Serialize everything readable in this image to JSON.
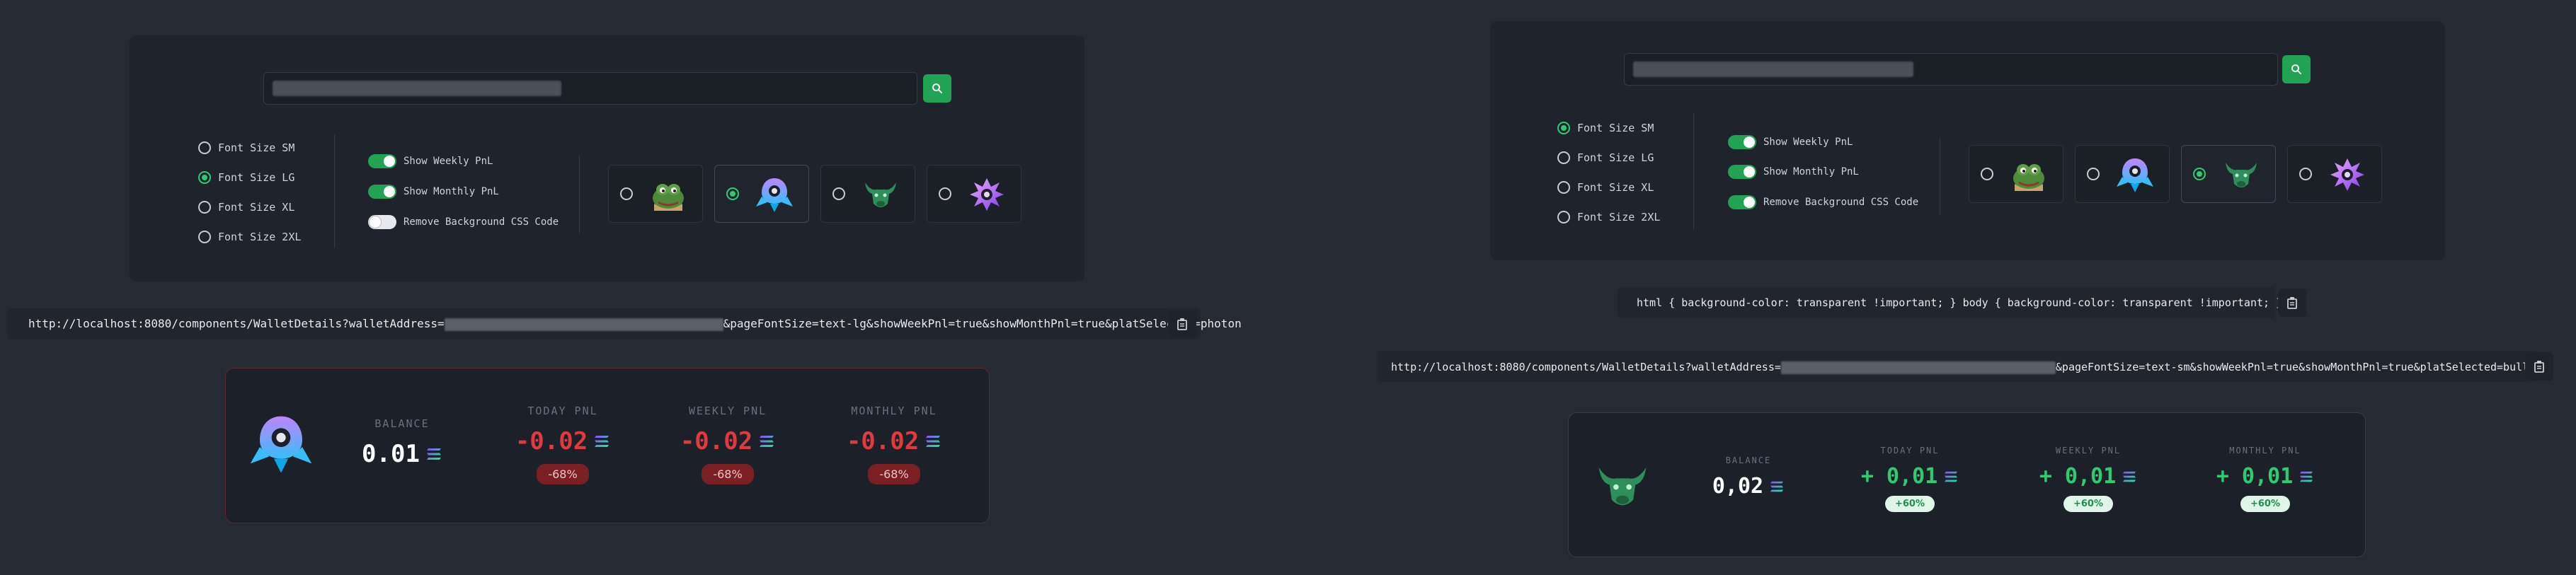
{
  "colors": {
    "background": "#252a33",
    "panel": "#1f242c",
    "accent_green": "#22a354",
    "negative_red": "#e0393e",
    "positive_green": "#2ecc71"
  },
  "left": {
    "font_options": [
      "Font Size SM",
      "Font Size LG",
      "Font Size XL",
      "Font Size 2XL"
    ],
    "font_selected": "Font Size LG",
    "toggles": [
      {
        "label": "Show Weekly PnL",
        "on": true
      },
      {
        "label": "Show Monthly PnL",
        "on": true
      },
      {
        "label": "Remove Background CSS Code",
        "on": false
      }
    ],
    "platforms": [
      "pepe",
      "photon",
      "bullx",
      "axiom"
    ],
    "platform_selected": "photon",
    "url_prefix": "http://localhost:8080/components/WalletDetails?walletAddress=",
    "url_suffix": "&pageFontSize=text-lg&showWeekPnl=true&showMonthPnl=true&platSelected=photon",
    "wallet": {
      "balance_label": "BALANCE",
      "balance": "0.01",
      "today_label": "TODAY PNL",
      "today": "-0.02",
      "today_pct": "-68%",
      "weekly_label": "WEEKLY PNL",
      "weekly": "-0.02",
      "weekly_pct": "-68%",
      "monthly_label": "MONTHLY PNL",
      "monthly": "-0.02",
      "monthly_pct": "-68%"
    }
  },
  "right": {
    "font_options": [
      "Font Size SM",
      "Font Size LG",
      "Font Size XL",
      "Font Size 2XL"
    ],
    "font_selected": "Font Size SM",
    "toggles": [
      {
        "label": "Show Weekly PnL",
        "on": true
      },
      {
        "label": "Show Monthly PnL",
        "on": true
      },
      {
        "label": "Remove Background CSS Code",
        "on": true
      }
    ],
    "platforms": [
      "pepe",
      "photon",
      "bullx",
      "axiom"
    ],
    "platform_selected": "bullx",
    "css_code": "html { background-color: transparent !important; } body { background-color: transparent !important; }",
    "url_prefix": "http://localhost:8080/components/WalletDetails?walletAddress=",
    "url_suffix": "&pageFontSize=text-sm&showWeekPnl=true&showMonthPnl=true&platSelected=bullx",
    "wallet": {
      "balance_label": "BALANCE",
      "balance": "0,02",
      "today_label": "TODAY PNL",
      "today": "+ 0,01",
      "today_pct": "+60%",
      "weekly_label": "WEEKLY PNL",
      "weekly": "+ 0,01",
      "weekly_pct": "+60%",
      "monthly_label": "MONTHLY PNL",
      "monthly": "+ 0,01",
      "monthly_pct": "+60%"
    }
  }
}
